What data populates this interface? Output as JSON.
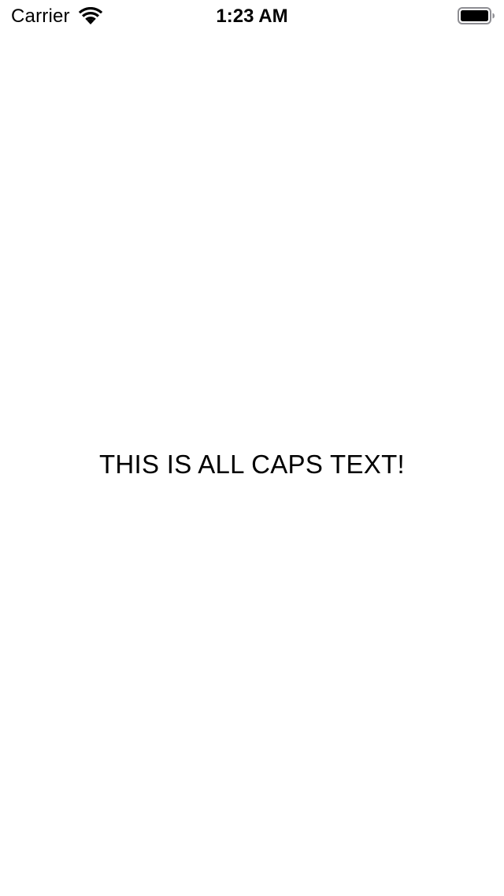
{
  "status_bar": {
    "carrier": "Carrier",
    "time": "1:23 AM",
    "wifi_icon": "wifi-icon",
    "battery_icon": "battery-icon",
    "battery_level": 1.0
  },
  "main": {
    "label": "THIS IS ALL CAPS TEXT!"
  },
  "colors": {
    "background": "#ffffff",
    "text": "#000000"
  }
}
